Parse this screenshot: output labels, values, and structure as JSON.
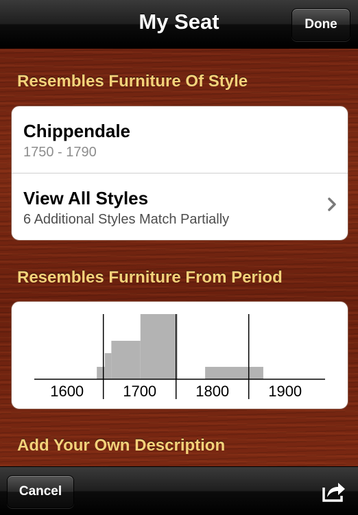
{
  "nav": {
    "title": "My Seat",
    "done_label": "Done"
  },
  "sections": {
    "style_header": "Resembles Furniture Of Style",
    "period_header": "Resembles Furniture From Period",
    "description_header": "Add Your Own Description"
  },
  "style_card": {
    "primary": {
      "title": "Chippendale",
      "subtitle": "1750 - 1790"
    },
    "all_styles": {
      "title": "View All Styles",
      "subtitle": "6 Additional Styles Match Partially"
    }
  },
  "toolbar": {
    "cancel_label": "Cancel"
  },
  "icons": {
    "chevron": "chevron-right-icon",
    "share": "share-icon"
  },
  "colors": {
    "header_text": "#f4d27a",
    "bar": "#b3b3b3"
  },
  "chart_data": {
    "type": "bar",
    "x_ticks": [
      "1600",
      "1700",
      "1800",
      "1900"
    ],
    "xlim": [
      1555,
      1955
    ],
    "ylim": [
      0,
      100
    ],
    "bars": [
      {
        "start": 1641,
        "end": 1652,
        "value": 19
      },
      {
        "start": 1652,
        "end": 1661,
        "value": 40
      },
      {
        "start": 1661,
        "end": 1701,
        "value": 59
      },
      {
        "start": 1701,
        "end": 1752,
        "value": 100
      },
      {
        "start": 1790,
        "end": 1870,
        "value": 19
      }
    ],
    "dividers": [
      1650,
      1750,
      1850
    ]
  }
}
